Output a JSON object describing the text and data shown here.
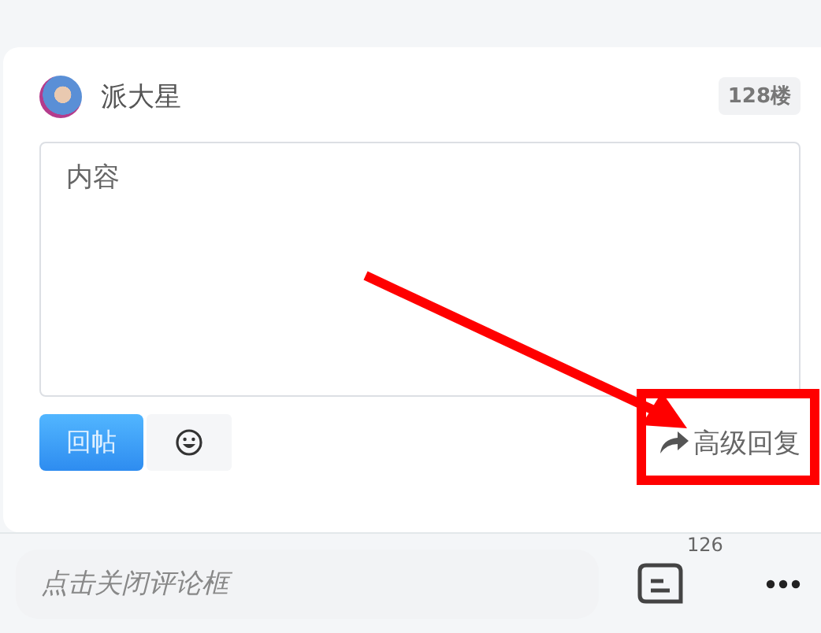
{
  "post": {
    "username": "派大星",
    "floor": "128楼"
  },
  "editor": {
    "placeholder": "内容"
  },
  "actions": {
    "submit": "回帖",
    "advanced_reply": "高级回复"
  },
  "bottom_bar": {
    "placeholder": "点击关闭评论框",
    "comment_count": "126"
  }
}
